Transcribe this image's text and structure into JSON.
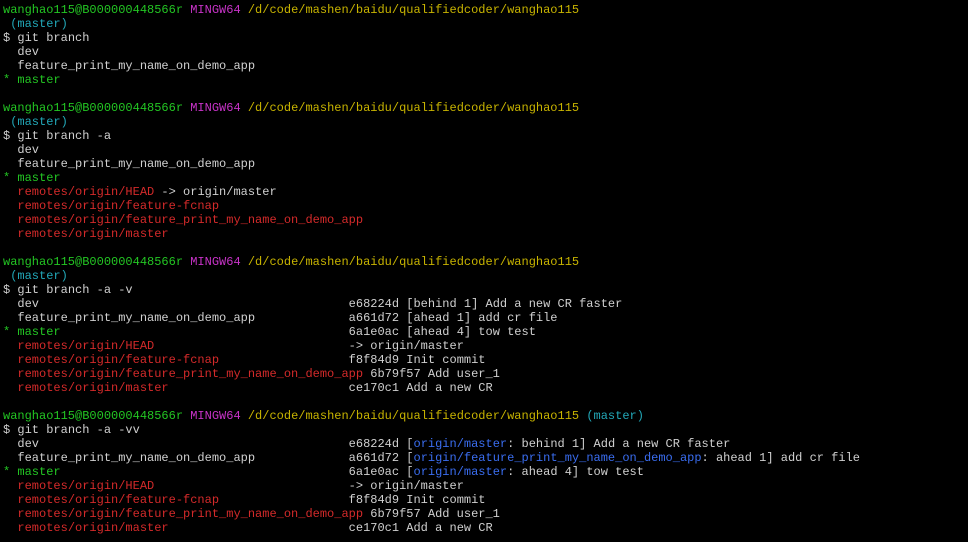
{
  "prompt": {
    "user_host": "wanghao115@B000000448566r",
    "msystem": "MINGW64",
    "path": "/d/code/mashen/baidu/qualifiedcoder/wanghao115",
    "branch": "(master)",
    "dollar": "$"
  },
  "blocks": [
    {
      "command": "git branch",
      "lines": [
        {
          "marker": " ",
          "text": "dev",
          "color": "white"
        },
        {
          "marker": " ",
          "text": "feature_print_my_name_on_demo_app",
          "color": "white"
        },
        {
          "marker": "*",
          "text": "master",
          "color": "green"
        }
      ]
    },
    {
      "command": "git branch -a",
      "lines": [
        {
          "marker": " ",
          "text": "dev",
          "color": "white"
        },
        {
          "marker": " ",
          "text": "feature_print_my_name_on_demo_app",
          "color": "white"
        },
        {
          "marker": "*",
          "text": "master",
          "color": "green"
        },
        {
          "marker": " ",
          "text": "remotes/origin/HEAD",
          "color": "red",
          "suffix": " -> origin/master"
        },
        {
          "marker": " ",
          "text": "remotes/origin/feature-fcnap",
          "color": "red"
        },
        {
          "marker": " ",
          "text": "remotes/origin/feature_print_my_name_on_demo_app",
          "color": "red"
        },
        {
          "marker": " ",
          "text": "remotes/origin/master",
          "color": "red"
        }
      ]
    },
    {
      "command": "git branch -a -v",
      "lines": [
        {
          "marker": " ",
          "text": "dev",
          "color": "white",
          "info": "e68224d [behind 1] Add a new CR faster"
        },
        {
          "marker": " ",
          "text": "feature_print_my_name_on_demo_app",
          "color": "white",
          "info": "a661d72 [ahead 1] add cr file"
        },
        {
          "marker": "*",
          "text": "master",
          "color": "green",
          "info": "6a1e0ac [ahead 4] tow test"
        },
        {
          "marker": " ",
          "text": "remotes/origin/HEAD",
          "color": "red",
          "info": "-> origin/master"
        },
        {
          "marker": " ",
          "text": "remotes/origin/feature-fcnap",
          "color": "red",
          "info": "f8f84d9 Init commit"
        },
        {
          "marker": " ",
          "text": "remotes/origin/feature_print_my_name_on_demo_app",
          "color": "red",
          "info": "6b79f57 Add user_1"
        },
        {
          "marker": " ",
          "text": "remotes/origin/master",
          "color": "red",
          "info": "ce170c1 Add a new CR"
        }
      ]
    },
    {
      "command": "git branch -a -vv",
      "inline_branch": true,
      "lines": [
        {
          "marker": " ",
          "text": "dev",
          "color": "white",
          "hash": "e68224d",
          "upstream": "origin/master",
          "after": ": behind 1] Add a new CR faster"
        },
        {
          "marker": " ",
          "text": "feature_print_my_name_on_demo_app",
          "color": "white",
          "hash": "a661d72",
          "upstream": "origin/feature_print_my_name_on_demo_app",
          "after": ": ahead 1] add cr file"
        },
        {
          "marker": "*",
          "text": "master",
          "color": "green",
          "hash": "6a1e0ac",
          "upstream": "origin/master",
          "after": ": ahead 4] tow test"
        },
        {
          "marker": " ",
          "text": "remotes/origin/HEAD",
          "color": "red",
          "info": "-> origin/master"
        },
        {
          "marker": " ",
          "text": "remotes/origin/feature-fcnap",
          "color": "red",
          "info": "f8f84d9 Init commit"
        },
        {
          "marker": " ",
          "text": "remotes/origin/feature_print_my_name_on_demo_app",
          "color": "red",
          "info": "6b79f57 Add user_1"
        },
        {
          "marker": " ",
          "text": "remotes/origin/master",
          "color": "red",
          "info": "ce170c1 Add a new CR"
        }
      ]
    }
  ],
  "colors": {
    "background": "#000000",
    "green": "#23c623",
    "magenta": "#c833c8",
    "yellow": "#c8b400",
    "cyan": "#22a8b8",
    "red": "#d42a2a",
    "blue": "#3a6df0",
    "white": "#d0d0d0"
  }
}
